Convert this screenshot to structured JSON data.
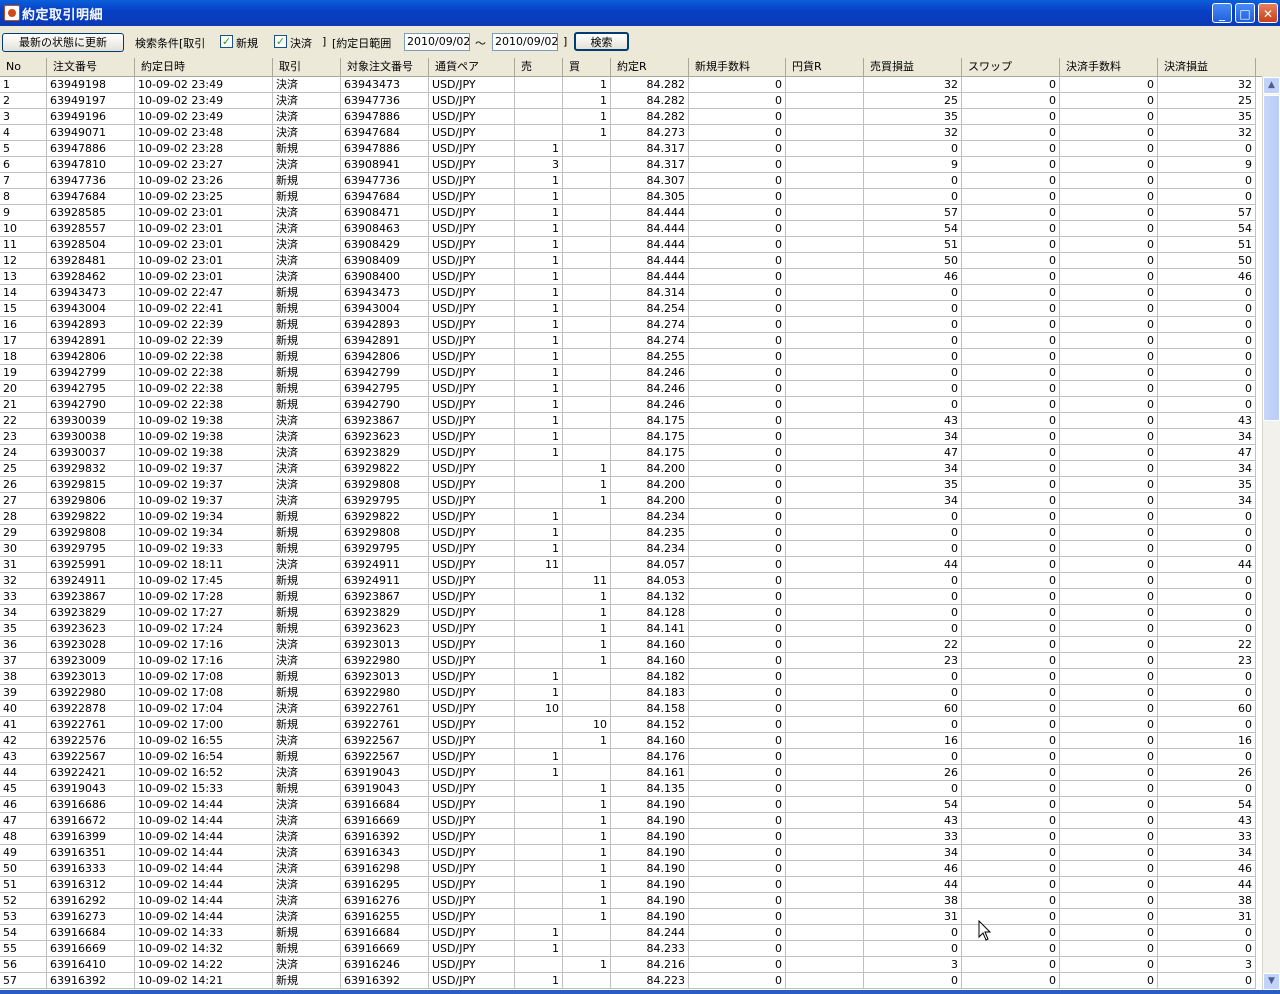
{
  "window": {
    "title": "約定取引明細",
    "minimize": "_",
    "maximize": "□",
    "close": "✕"
  },
  "toolbar": {
    "refresh_label": "最新の状態に更新",
    "search_cond_label": "検索条件[取引",
    "new_label": "新規",
    "settle_label": "決済",
    "bracket_close": "]",
    "date_range_label": "[約定日範囲",
    "date_from": "2010/09/02",
    "tilde": "〜",
    "date_to": "2010/09/02",
    "bracket_close2": "]",
    "search_label": "検索",
    "new_checked": true,
    "settle_checked": true
  },
  "columns": [
    "No",
    "注文番号",
    "約定日時",
    "取引",
    "対象注文番号",
    "通貨ペア",
    "売",
    "買",
    "約定R",
    "新規手数料",
    "円貨R",
    "売買損益",
    "スワップ",
    "決済手数料",
    "決済損益"
  ],
  "rows": [
    [
      "1",
      "63949198",
      "10-09-02 23:49",
      "決済",
      "63943473",
      "USD/JPY",
      "",
      "1",
      "84.282",
      "0",
      "",
      "32",
      "0",
      "0",
      "32"
    ],
    [
      "2",
      "63949197",
      "10-09-02 23:49",
      "決済",
      "63947736",
      "USD/JPY",
      "",
      "1",
      "84.282",
      "0",
      "",
      "25",
      "0",
      "0",
      "25"
    ],
    [
      "3",
      "63949196",
      "10-09-02 23:49",
      "決済",
      "63947886",
      "USD/JPY",
      "",
      "1",
      "84.282",
      "0",
      "",
      "35",
      "0",
      "0",
      "35"
    ],
    [
      "4",
      "63949071",
      "10-09-02 23:48",
      "決済",
      "63947684",
      "USD/JPY",
      "",
      "1",
      "84.273",
      "0",
      "",
      "32",
      "0",
      "0",
      "32"
    ],
    [
      "5",
      "63947886",
      "10-09-02 23:28",
      "新規",
      "63947886",
      "USD/JPY",
      "1",
      "",
      "84.317",
      "0",
      "",
      "0",
      "0",
      "0",
      "0"
    ],
    [
      "6",
      "63947810",
      "10-09-02 23:27",
      "決済",
      "63908941",
      "USD/JPY",
      "3",
      "",
      "84.317",
      "0",
      "",
      "9",
      "0",
      "0",
      "9"
    ],
    [
      "7",
      "63947736",
      "10-09-02 23:26",
      "新規",
      "63947736",
      "USD/JPY",
      "1",
      "",
      "84.307",
      "0",
      "",
      "0",
      "0",
      "0",
      "0"
    ],
    [
      "8",
      "63947684",
      "10-09-02 23:25",
      "新規",
      "63947684",
      "USD/JPY",
      "1",
      "",
      "84.305",
      "0",
      "",
      "0",
      "0",
      "0",
      "0"
    ],
    [
      "9",
      "63928585",
      "10-09-02 23:01",
      "決済",
      "63908471",
      "USD/JPY",
      "1",
      "",
      "84.444",
      "0",
      "",
      "57",
      "0",
      "0",
      "57"
    ],
    [
      "10",
      "63928557",
      "10-09-02 23:01",
      "決済",
      "63908463",
      "USD/JPY",
      "1",
      "",
      "84.444",
      "0",
      "",
      "54",
      "0",
      "0",
      "54"
    ],
    [
      "11",
      "63928504",
      "10-09-02 23:01",
      "決済",
      "63908429",
      "USD/JPY",
      "1",
      "",
      "84.444",
      "0",
      "",
      "51",
      "0",
      "0",
      "51"
    ],
    [
      "12",
      "63928481",
      "10-09-02 23:01",
      "決済",
      "63908409",
      "USD/JPY",
      "1",
      "",
      "84.444",
      "0",
      "",
      "50",
      "0",
      "0",
      "50"
    ],
    [
      "13",
      "63928462",
      "10-09-02 23:01",
      "決済",
      "63908400",
      "USD/JPY",
      "1",
      "",
      "84.444",
      "0",
      "",
      "46",
      "0",
      "0",
      "46"
    ],
    [
      "14",
      "63943473",
      "10-09-02 22:47",
      "新規",
      "63943473",
      "USD/JPY",
      "1",
      "",
      "84.314",
      "0",
      "",
      "0",
      "0",
      "0",
      "0"
    ],
    [
      "15",
      "63943004",
      "10-09-02 22:41",
      "新規",
      "63943004",
      "USD/JPY",
      "1",
      "",
      "84.254",
      "0",
      "",
      "0",
      "0",
      "0",
      "0"
    ],
    [
      "16",
      "63942893",
      "10-09-02 22:39",
      "新規",
      "63942893",
      "USD/JPY",
      "1",
      "",
      "84.274",
      "0",
      "",
      "0",
      "0",
      "0",
      "0"
    ],
    [
      "17",
      "63942891",
      "10-09-02 22:39",
      "新規",
      "63942891",
      "USD/JPY",
      "1",
      "",
      "84.274",
      "0",
      "",
      "0",
      "0",
      "0",
      "0"
    ],
    [
      "18",
      "63942806",
      "10-09-02 22:38",
      "新規",
      "63942806",
      "USD/JPY",
      "1",
      "",
      "84.255",
      "0",
      "",
      "0",
      "0",
      "0",
      "0"
    ],
    [
      "19",
      "63942799",
      "10-09-02 22:38",
      "新規",
      "63942799",
      "USD/JPY",
      "1",
      "",
      "84.246",
      "0",
      "",
      "0",
      "0",
      "0",
      "0"
    ],
    [
      "20",
      "63942795",
      "10-09-02 22:38",
      "新規",
      "63942795",
      "USD/JPY",
      "1",
      "",
      "84.246",
      "0",
      "",
      "0",
      "0",
      "0",
      "0"
    ],
    [
      "21",
      "63942790",
      "10-09-02 22:38",
      "新規",
      "63942790",
      "USD/JPY",
      "1",
      "",
      "84.246",
      "0",
      "",
      "0",
      "0",
      "0",
      "0"
    ],
    [
      "22",
      "63930039",
      "10-09-02 19:38",
      "決済",
      "63923867",
      "USD/JPY",
      "1",
      "",
      "84.175",
      "0",
      "",
      "43",
      "0",
      "0",
      "43"
    ],
    [
      "23",
      "63930038",
      "10-09-02 19:38",
      "決済",
      "63923623",
      "USD/JPY",
      "1",
      "",
      "84.175",
      "0",
      "",
      "34",
      "0",
      "0",
      "34"
    ],
    [
      "24",
      "63930037",
      "10-09-02 19:38",
      "決済",
      "63923829",
      "USD/JPY",
      "1",
      "",
      "84.175",
      "0",
      "",
      "47",
      "0",
      "0",
      "47"
    ],
    [
      "25",
      "63929832",
      "10-09-02 19:37",
      "決済",
      "63929822",
      "USD/JPY",
      "",
      "1",
      "84.200",
      "0",
      "",
      "34",
      "0",
      "0",
      "34"
    ],
    [
      "26",
      "63929815",
      "10-09-02 19:37",
      "決済",
      "63929808",
      "USD/JPY",
      "",
      "1",
      "84.200",
      "0",
      "",
      "35",
      "0",
      "0",
      "35"
    ],
    [
      "27",
      "63929806",
      "10-09-02 19:37",
      "決済",
      "63929795",
      "USD/JPY",
      "",
      "1",
      "84.200",
      "0",
      "",
      "34",
      "0",
      "0",
      "34"
    ],
    [
      "28",
      "63929822",
      "10-09-02 19:34",
      "新規",
      "63929822",
      "USD/JPY",
      "1",
      "",
      "84.234",
      "0",
      "",
      "0",
      "0",
      "0",
      "0"
    ],
    [
      "29",
      "63929808",
      "10-09-02 19:34",
      "新規",
      "63929808",
      "USD/JPY",
      "1",
      "",
      "84.235",
      "0",
      "",
      "0",
      "0",
      "0",
      "0"
    ],
    [
      "30",
      "63929795",
      "10-09-02 19:33",
      "新規",
      "63929795",
      "USD/JPY",
      "1",
      "",
      "84.234",
      "0",
      "",
      "0",
      "0",
      "0",
      "0"
    ],
    [
      "31",
      "63925991",
      "10-09-02 18:11",
      "決済",
      "63924911",
      "USD/JPY",
      "11",
      "",
      "84.057",
      "0",
      "",
      "44",
      "0",
      "0",
      "44"
    ],
    [
      "32",
      "63924911",
      "10-09-02 17:45",
      "新規",
      "63924911",
      "USD/JPY",
      "",
      "11",
      "84.053",
      "0",
      "",
      "0",
      "0",
      "0",
      "0"
    ],
    [
      "33",
      "63923867",
      "10-09-02 17:28",
      "新規",
      "63923867",
      "USD/JPY",
      "",
      "1",
      "84.132",
      "0",
      "",
      "0",
      "0",
      "0",
      "0"
    ],
    [
      "34",
      "63923829",
      "10-09-02 17:27",
      "新規",
      "63923829",
      "USD/JPY",
      "",
      "1",
      "84.128",
      "0",
      "",
      "0",
      "0",
      "0",
      "0"
    ],
    [
      "35",
      "63923623",
      "10-09-02 17:24",
      "新規",
      "63923623",
      "USD/JPY",
      "",
      "1",
      "84.141",
      "0",
      "",
      "0",
      "0",
      "0",
      "0"
    ],
    [
      "36",
      "63923028",
      "10-09-02 17:16",
      "決済",
      "63923013",
      "USD/JPY",
      "",
      "1",
      "84.160",
      "0",
      "",
      "22",
      "0",
      "0",
      "22"
    ],
    [
      "37",
      "63923009",
      "10-09-02 17:16",
      "決済",
      "63922980",
      "USD/JPY",
      "",
      "1",
      "84.160",
      "0",
      "",
      "23",
      "0",
      "0",
      "23"
    ],
    [
      "38",
      "63923013",
      "10-09-02 17:08",
      "新規",
      "63923013",
      "USD/JPY",
      "1",
      "",
      "84.182",
      "0",
      "",
      "0",
      "0",
      "0",
      "0"
    ],
    [
      "39",
      "63922980",
      "10-09-02 17:08",
      "新規",
      "63922980",
      "USD/JPY",
      "1",
      "",
      "84.183",
      "0",
      "",
      "0",
      "0",
      "0",
      "0"
    ],
    [
      "40",
      "63922878",
      "10-09-02 17:04",
      "決済",
      "63922761",
      "USD/JPY",
      "10",
      "",
      "84.158",
      "0",
      "",
      "60",
      "0",
      "0",
      "60"
    ],
    [
      "41",
      "63922761",
      "10-09-02 17:00",
      "新規",
      "63922761",
      "USD/JPY",
      "",
      "10",
      "84.152",
      "0",
      "",
      "0",
      "0",
      "0",
      "0"
    ],
    [
      "42",
      "63922576",
      "10-09-02 16:55",
      "決済",
      "63922567",
      "USD/JPY",
      "",
      "1",
      "84.160",
      "0",
      "",
      "16",
      "0",
      "0",
      "16"
    ],
    [
      "43",
      "63922567",
      "10-09-02 16:54",
      "新規",
      "63922567",
      "USD/JPY",
      "1",
      "",
      "84.176",
      "0",
      "",
      "0",
      "0",
      "0",
      "0"
    ],
    [
      "44",
      "63922421",
      "10-09-02 16:52",
      "決済",
      "63919043",
      "USD/JPY",
      "1",
      "",
      "84.161",
      "0",
      "",
      "26",
      "0",
      "0",
      "26"
    ],
    [
      "45",
      "63919043",
      "10-09-02 15:33",
      "新規",
      "63919043",
      "USD/JPY",
      "",
      "1",
      "84.135",
      "0",
      "",
      "0",
      "0",
      "0",
      "0"
    ],
    [
      "46",
      "63916686",
      "10-09-02 14:44",
      "決済",
      "63916684",
      "USD/JPY",
      "",
      "1",
      "84.190",
      "0",
      "",
      "54",
      "0",
      "0",
      "54"
    ],
    [
      "47",
      "63916672",
      "10-09-02 14:44",
      "決済",
      "63916669",
      "USD/JPY",
      "",
      "1",
      "84.190",
      "0",
      "",
      "43",
      "0",
      "0",
      "43"
    ],
    [
      "48",
      "63916399",
      "10-09-02 14:44",
      "決済",
      "63916392",
      "USD/JPY",
      "",
      "1",
      "84.190",
      "0",
      "",
      "33",
      "0",
      "0",
      "33"
    ],
    [
      "49",
      "63916351",
      "10-09-02 14:44",
      "決済",
      "63916343",
      "USD/JPY",
      "",
      "1",
      "84.190",
      "0",
      "",
      "34",
      "0",
      "0",
      "34"
    ],
    [
      "50",
      "63916333",
      "10-09-02 14:44",
      "決済",
      "63916298",
      "USD/JPY",
      "",
      "1",
      "84.190",
      "0",
      "",
      "46",
      "0",
      "0",
      "46"
    ],
    [
      "51",
      "63916312",
      "10-09-02 14:44",
      "決済",
      "63916295",
      "USD/JPY",
      "",
      "1",
      "84.190",
      "0",
      "",
      "44",
      "0",
      "0",
      "44"
    ],
    [
      "52",
      "63916292",
      "10-09-02 14:44",
      "決済",
      "63916276",
      "USD/JPY",
      "",
      "1",
      "84.190",
      "0",
      "",
      "38",
      "0",
      "0",
      "38"
    ],
    [
      "53",
      "63916273",
      "10-09-02 14:44",
      "決済",
      "63916255",
      "USD/JPY",
      "",
      "1",
      "84.190",
      "0",
      "",
      "31",
      "0",
      "0",
      "31"
    ],
    [
      "54",
      "63916684",
      "10-09-02 14:33",
      "新規",
      "63916684",
      "USD/JPY",
      "1",
      "",
      "84.244",
      "0",
      "",
      "0",
      "0",
      "0",
      "0"
    ],
    [
      "55",
      "63916669",
      "10-09-02 14:32",
      "新規",
      "63916669",
      "USD/JPY",
      "1",
      "",
      "84.233",
      "0",
      "",
      "0",
      "0",
      "0",
      "0"
    ],
    [
      "56",
      "63916410",
      "10-09-02 14:22",
      "決済",
      "63916246",
      "USD/JPY",
      "",
      "1",
      "84.216",
      "0",
      "",
      "3",
      "0",
      "0",
      "3"
    ],
    [
      "57",
      "63916392",
      "10-09-02 14:21",
      "新規",
      "63916392",
      "USD/JPY",
      "1",
      "",
      "84.223",
      "0",
      "",
      "0",
      "0",
      "0",
      "0"
    ]
  ],
  "scrollbar": {
    "up": "▲",
    "down": "▼"
  }
}
